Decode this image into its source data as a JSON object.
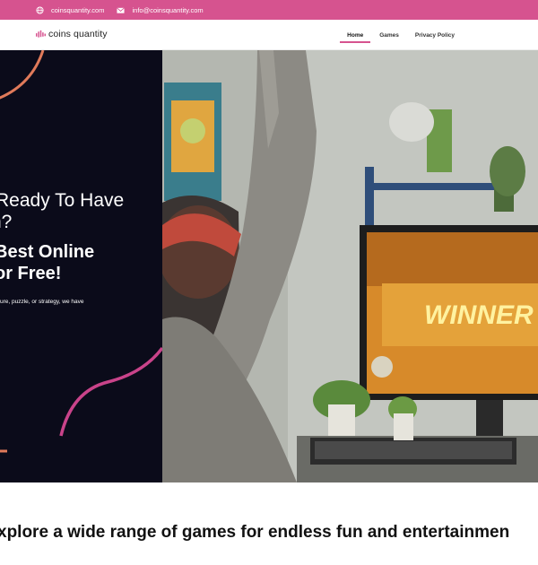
{
  "topbar": {
    "website": "coinsquantity.com",
    "email": "info@coinsquantity.com",
    "icons": [
      "globe-icon",
      "envelope-icon"
    ]
  },
  "header": {
    "logo_text": "coins quantity",
    "nav": [
      {
        "label": "Home",
        "active": true
      },
      {
        "label": "Games",
        "active": false
      },
      {
        "label": "Privacy Policy",
        "active": false
      }
    ]
  },
  "hero": {
    "line1": "Ready To Have",
    "line2": "n?",
    "line3": "Best Online",
    "line4": "or Free!",
    "subtitle": "ure, puzzle, or strategy, we have",
    "screen_text": "WINNER"
  },
  "section": {
    "title": "xplore a wide range of games for endless fun and entertainmen"
  },
  "colors": {
    "accent": "#d6538f",
    "hero_dark": "#0b0b1a",
    "orange_curve": "#e07a5a"
  }
}
